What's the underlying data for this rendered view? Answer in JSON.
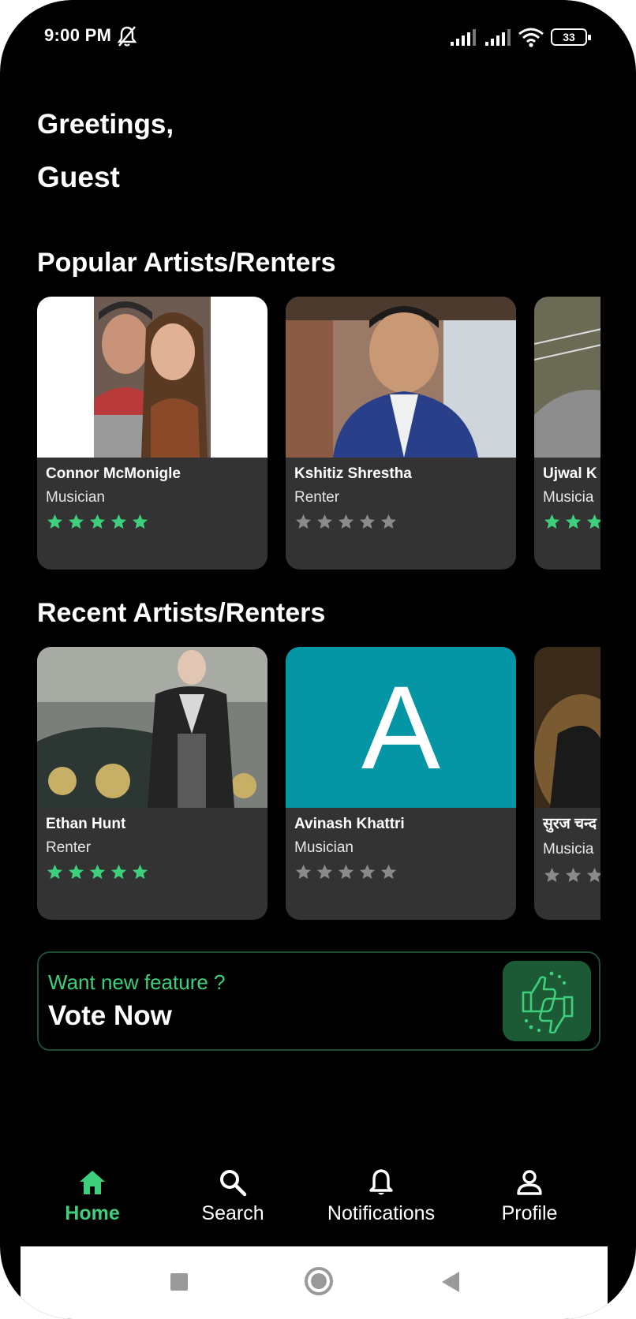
{
  "status_bar": {
    "time": "9:00 PM",
    "battery": "33",
    "icons": [
      "bell-off-icon",
      "signal-icon",
      "signal-icon",
      "wifi-icon",
      "battery-icon"
    ]
  },
  "greeting": {
    "line1": "Greetings,",
    "line2": "Guest"
  },
  "sections": {
    "popular_title": "Popular Artists/Renters",
    "recent_title": "Recent Artists/Renters"
  },
  "popular": [
    {
      "name": "Connor McMonigle",
      "role": "Musician",
      "rating": 5
    },
    {
      "name": "Kshitiz Shrestha",
      "role": "Renter",
      "rating": 0
    },
    {
      "name": "Ujwal K",
      "role": "Musicia",
      "rating": 5
    }
  ],
  "recent": [
    {
      "name": "Ethan Hunt",
      "role": "Renter",
      "rating": 5
    },
    {
      "name": "Avinash Khattri",
      "role": "Musician",
      "rating": 0,
      "avatar_letter": "A"
    },
    {
      "name": "सुरज चन्द",
      "role": "Musicia",
      "rating": 0
    }
  ],
  "vote": {
    "subtitle": "Want new feature ?",
    "title": "Vote Now",
    "icon": "thumbs-vote-icon"
  },
  "nav": {
    "home": "Home",
    "search": "Search",
    "notifications": "Notifications",
    "profile": "Profile"
  },
  "colors": {
    "accent": "#3ecf7c",
    "card_bg": "#333333",
    "star_empty": "#8a8a8a",
    "avatar_teal": "#0596a6"
  }
}
